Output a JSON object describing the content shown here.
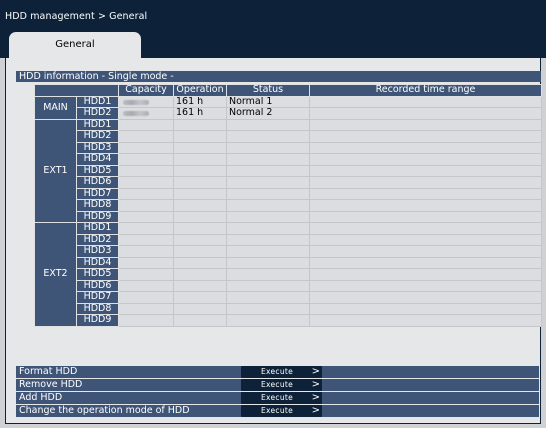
{
  "header": {
    "breadcrumb": "HDD management > General"
  },
  "tabs": [
    {
      "label": "General"
    }
  ],
  "section": {
    "title": "HDD information - Single mode -"
  },
  "table": {
    "columns": [
      "Capacity",
      "Operation",
      "Status",
      "Recorded time range"
    ],
    "groups": [
      {
        "name": "MAIN",
        "rows": [
          {
            "hdd": "HDD1",
            "operation": "161 h",
            "status": "Normal 1",
            "capacity_obscured": true
          },
          {
            "hdd": "HDD2",
            "operation": "161 h",
            "status": "Normal 2",
            "capacity_obscured": true
          }
        ]
      },
      {
        "name": "EXT1",
        "rows": [
          {
            "hdd": "HDD1"
          },
          {
            "hdd": "HDD2"
          },
          {
            "hdd": "HDD3"
          },
          {
            "hdd": "HDD4"
          },
          {
            "hdd": "HDD5"
          },
          {
            "hdd": "HDD6"
          },
          {
            "hdd": "HDD7"
          },
          {
            "hdd": "HDD8"
          },
          {
            "hdd": "HDD9"
          }
        ]
      },
      {
        "name": "EXT2",
        "rows": [
          {
            "hdd": "HDD1"
          },
          {
            "hdd": "HDD2"
          },
          {
            "hdd": "HDD3"
          },
          {
            "hdd": "HDD4"
          },
          {
            "hdd": "HDD5"
          },
          {
            "hdd": "HDD6"
          },
          {
            "hdd": "HDD7"
          },
          {
            "hdd": "HDD8"
          },
          {
            "hdd": "HDD9"
          }
        ]
      }
    ]
  },
  "actions": [
    {
      "label": "Format HDD",
      "button": "Execute"
    },
    {
      "label": "Remove HDD",
      "button": "Execute"
    },
    {
      "label": "Add HDD",
      "button": "Execute"
    },
    {
      "label": "Change the operation mode of HDD",
      "button": "Execute"
    }
  ],
  "colors": {
    "header_bg": "#0d2238",
    "cell_header_bg": "#3f5578",
    "panel_bg": "#e6e7e9"
  }
}
